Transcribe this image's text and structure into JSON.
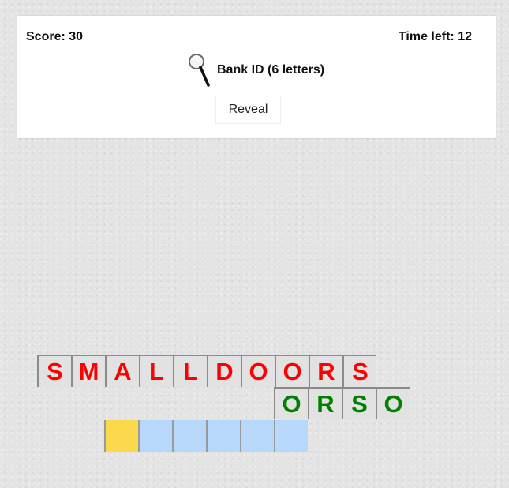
{
  "header": {
    "score": "Score: 30",
    "time_left": "Time left: 12",
    "clue": "Bank ID (6 letters)",
    "clue_icon": "magnifying-glass-icon",
    "reveal_label": "Reveal"
  },
  "colors": {
    "found_letters": "#ff0000",
    "candidate_letters": "#008000",
    "answer_slot": "#b7d8fb",
    "active_slot": "#fcd94a"
  },
  "board": {
    "row1": [
      "S",
      "M",
      "A",
      "L",
      "L",
      "D",
      "O",
      "O",
      "R",
      "S"
    ],
    "row2": [
      "O",
      "R",
      "S",
      "O"
    ],
    "answer_slots": 6,
    "active_slot_index": 0
  }
}
